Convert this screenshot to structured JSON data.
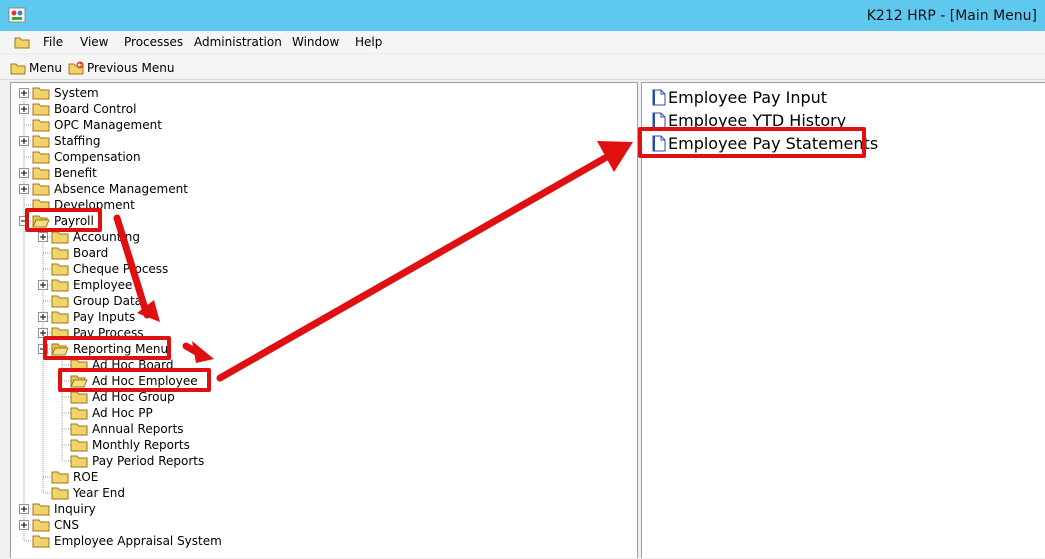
{
  "window": {
    "title": "K212 HRP - [Main Menu]"
  },
  "menubar": {
    "items": [
      "File",
      "View",
      "Processes",
      "Administration",
      "Window",
      "Help"
    ]
  },
  "toolbar": {
    "menu_label": "Menu",
    "previous_label": "Previous Menu"
  },
  "tree": {
    "system": "System",
    "board_control": "Board Control",
    "opc_management": "OPC Management",
    "staffing": "Staffing",
    "compensation": "Compensation",
    "benefit": "Benefit",
    "absence_management": "Absence Management",
    "development": "Development",
    "payroll": "Payroll",
    "accounting": "Accounting",
    "board": "Board",
    "cheque_process": "Cheque Process",
    "employee": "Employee",
    "group_data": "Group Data",
    "pay_inputs": "Pay Inputs",
    "pay_process": "Pay Process",
    "reporting_menu": "Reporting Menu",
    "ad_hoc_board": "Ad Hoc Board",
    "ad_hoc_employee": "Ad Hoc Employee",
    "ad_hoc_group": "Ad Hoc Group",
    "ad_hoc_pp": "Ad Hoc PP",
    "annual_reports": "Annual Reports",
    "monthly_reports": "Monthly Reports",
    "pay_period_reports": "Pay Period Reports",
    "roe": "ROE",
    "year_end": "Year End",
    "inquiry": "Inquiry",
    "cns": "CNS",
    "employee_appraisal_system": "Employee Appraisal System"
  },
  "list": {
    "items": [
      "Employee Pay Input",
      "Employee YTD History",
      "Employee Pay Statements"
    ]
  },
  "colors": {
    "titlebar": "#5ec8ee",
    "callout": "#e01010",
    "folder": "#f2d36b"
  }
}
